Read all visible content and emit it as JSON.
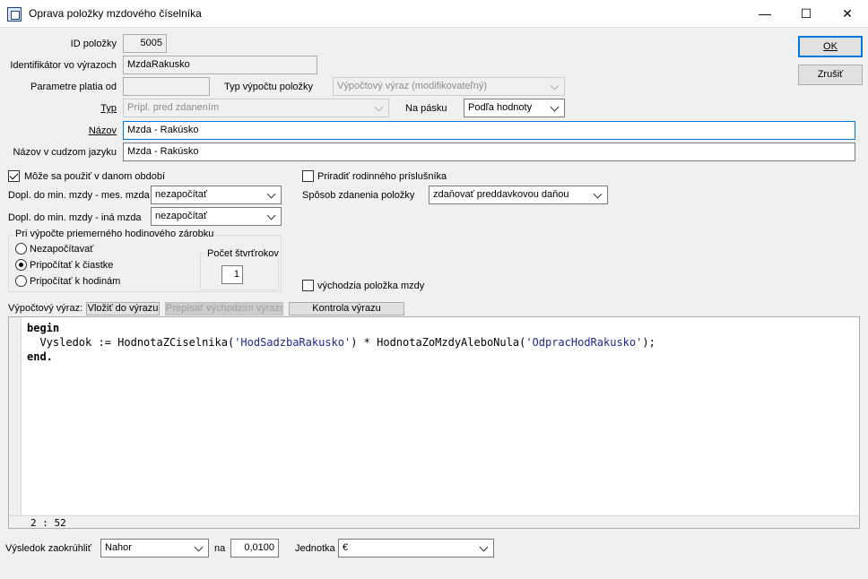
{
  "window": {
    "title": "Oprava položky mzdového číselníka",
    "minimize": "—",
    "maximize": "☐",
    "close": "✕"
  },
  "buttons": {
    "ok": "OK",
    "cancel": "Zrušiť"
  },
  "form": {
    "id_label": "ID položky",
    "id_value": "5005",
    "identifier_label": "Identifikátor vo výrazoch",
    "identifier_value": "MzdaRakusko",
    "params_label": "Parametre platia od",
    "params_value": "",
    "calc_type_label": "Typ výpočtu položky",
    "calc_type_value": "Výpočtový výraz (modifikovateľný)",
    "type_label": "Typ",
    "type_value": "Prípl. pred zdanením",
    "payslip_label": "Na pásku",
    "payslip_value": "Podľa hodnoty",
    "name_label": "Názov",
    "name_value": "Mzda - Rakúsko",
    "foreign_name_label": "Názov v cudzom jazyku",
    "foreign_name_value": "Mzda - Rakúsko"
  },
  "options": {
    "use_in_period_label": "Môže sa použiť v danom období",
    "use_in_period_checked": true,
    "assign_family_label": "Priradiť rodinného príslušníka",
    "assign_family_checked": false,
    "min_wage_month_label": "Dopl. do min. mzdy - mes. mzda",
    "min_wage_month_value": "nezapočítať",
    "min_wage_other_label": "Dopl. do min. mzdy - iná mzda",
    "min_wage_other_value": "nezapočítať",
    "taxation_label": "Spôsob zdanenia položky",
    "taxation_value": "zdaňovať preddavkovou daňou",
    "default_item_label": "východzia položka mzdy",
    "default_item_checked": false
  },
  "average_earnings": {
    "title": "Pri výpočte priemerného hodinového zárobku",
    "radios": [
      {
        "label": "Nezapočítavať",
        "selected": false
      },
      {
        "label": "Pripočítať k čiastke",
        "selected": true
      },
      {
        "label": "Pripočítať k hodinám",
        "selected": false
      }
    ],
    "quarters_label": "Počet štvrťrokov",
    "quarters_value": "1"
  },
  "expression": {
    "label": "Výpočtový výraz:",
    "insert_button": "Vložiť do výrazu",
    "overwrite_button": "Prepísať východzím výrazom",
    "check_button": "Kontrola výrazu",
    "code": {
      "line1": "begin",
      "line2_pre": "  Vysledok := HodnotaZCiselnika(",
      "line2_str1": "'HodSadzbaRakusko'",
      "line2_mid": ") * HodnotaZoMzdyAleboNula(",
      "line2_str2": "'OdpracHodRakusko'",
      "line2_post": ");",
      "line3": "end."
    },
    "cursor_pos": "2 : 52"
  },
  "footer": {
    "rounding_label": "Výsledok zaokrúhliť",
    "rounding_value": "Nahor",
    "to_label": "na",
    "to_value": "0,0100",
    "unit_label": "Jednotka",
    "unit_value": "€"
  }
}
